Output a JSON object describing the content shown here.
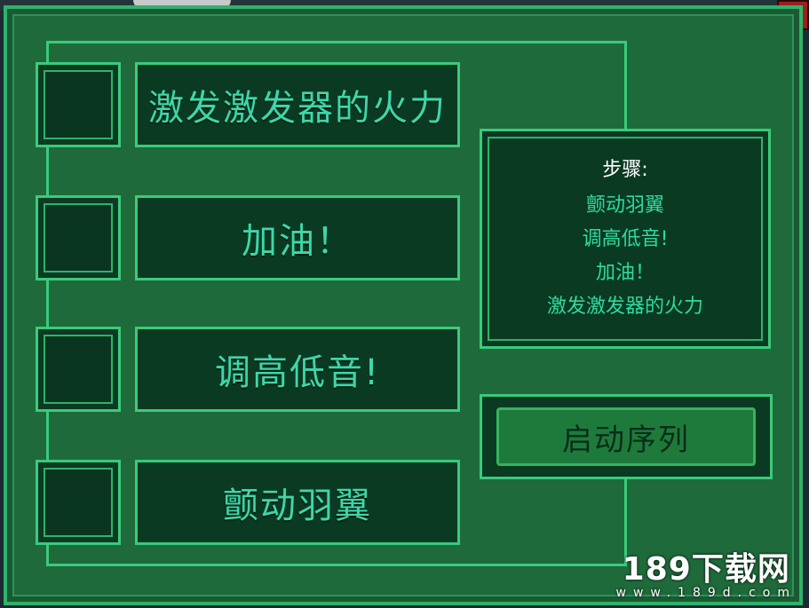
{
  "close_button": {
    "glyph": "✕",
    "icon": "close-icon"
  },
  "tasks": [
    {
      "label": "激发激发器的火力"
    },
    {
      "label": "加油！"
    },
    {
      "label": "调高低音!"
    },
    {
      "label": "颤动羽翼"
    }
  ],
  "info": {
    "title": "步骤:",
    "steps": [
      "颤动羽翼",
      "调高低音!",
      "加油！",
      "激发激发器的火力"
    ]
  },
  "start_button": {
    "label": "启动序列"
  },
  "watermark": {
    "main": "189下载网",
    "sub": "www.189d.com"
  },
  "colors": {
    "panel": "#1f6a3b",
    "border": "#3acb7b",
    "text": "#3fd6a9",
    "close": "#9b1f1f"
  }
}
